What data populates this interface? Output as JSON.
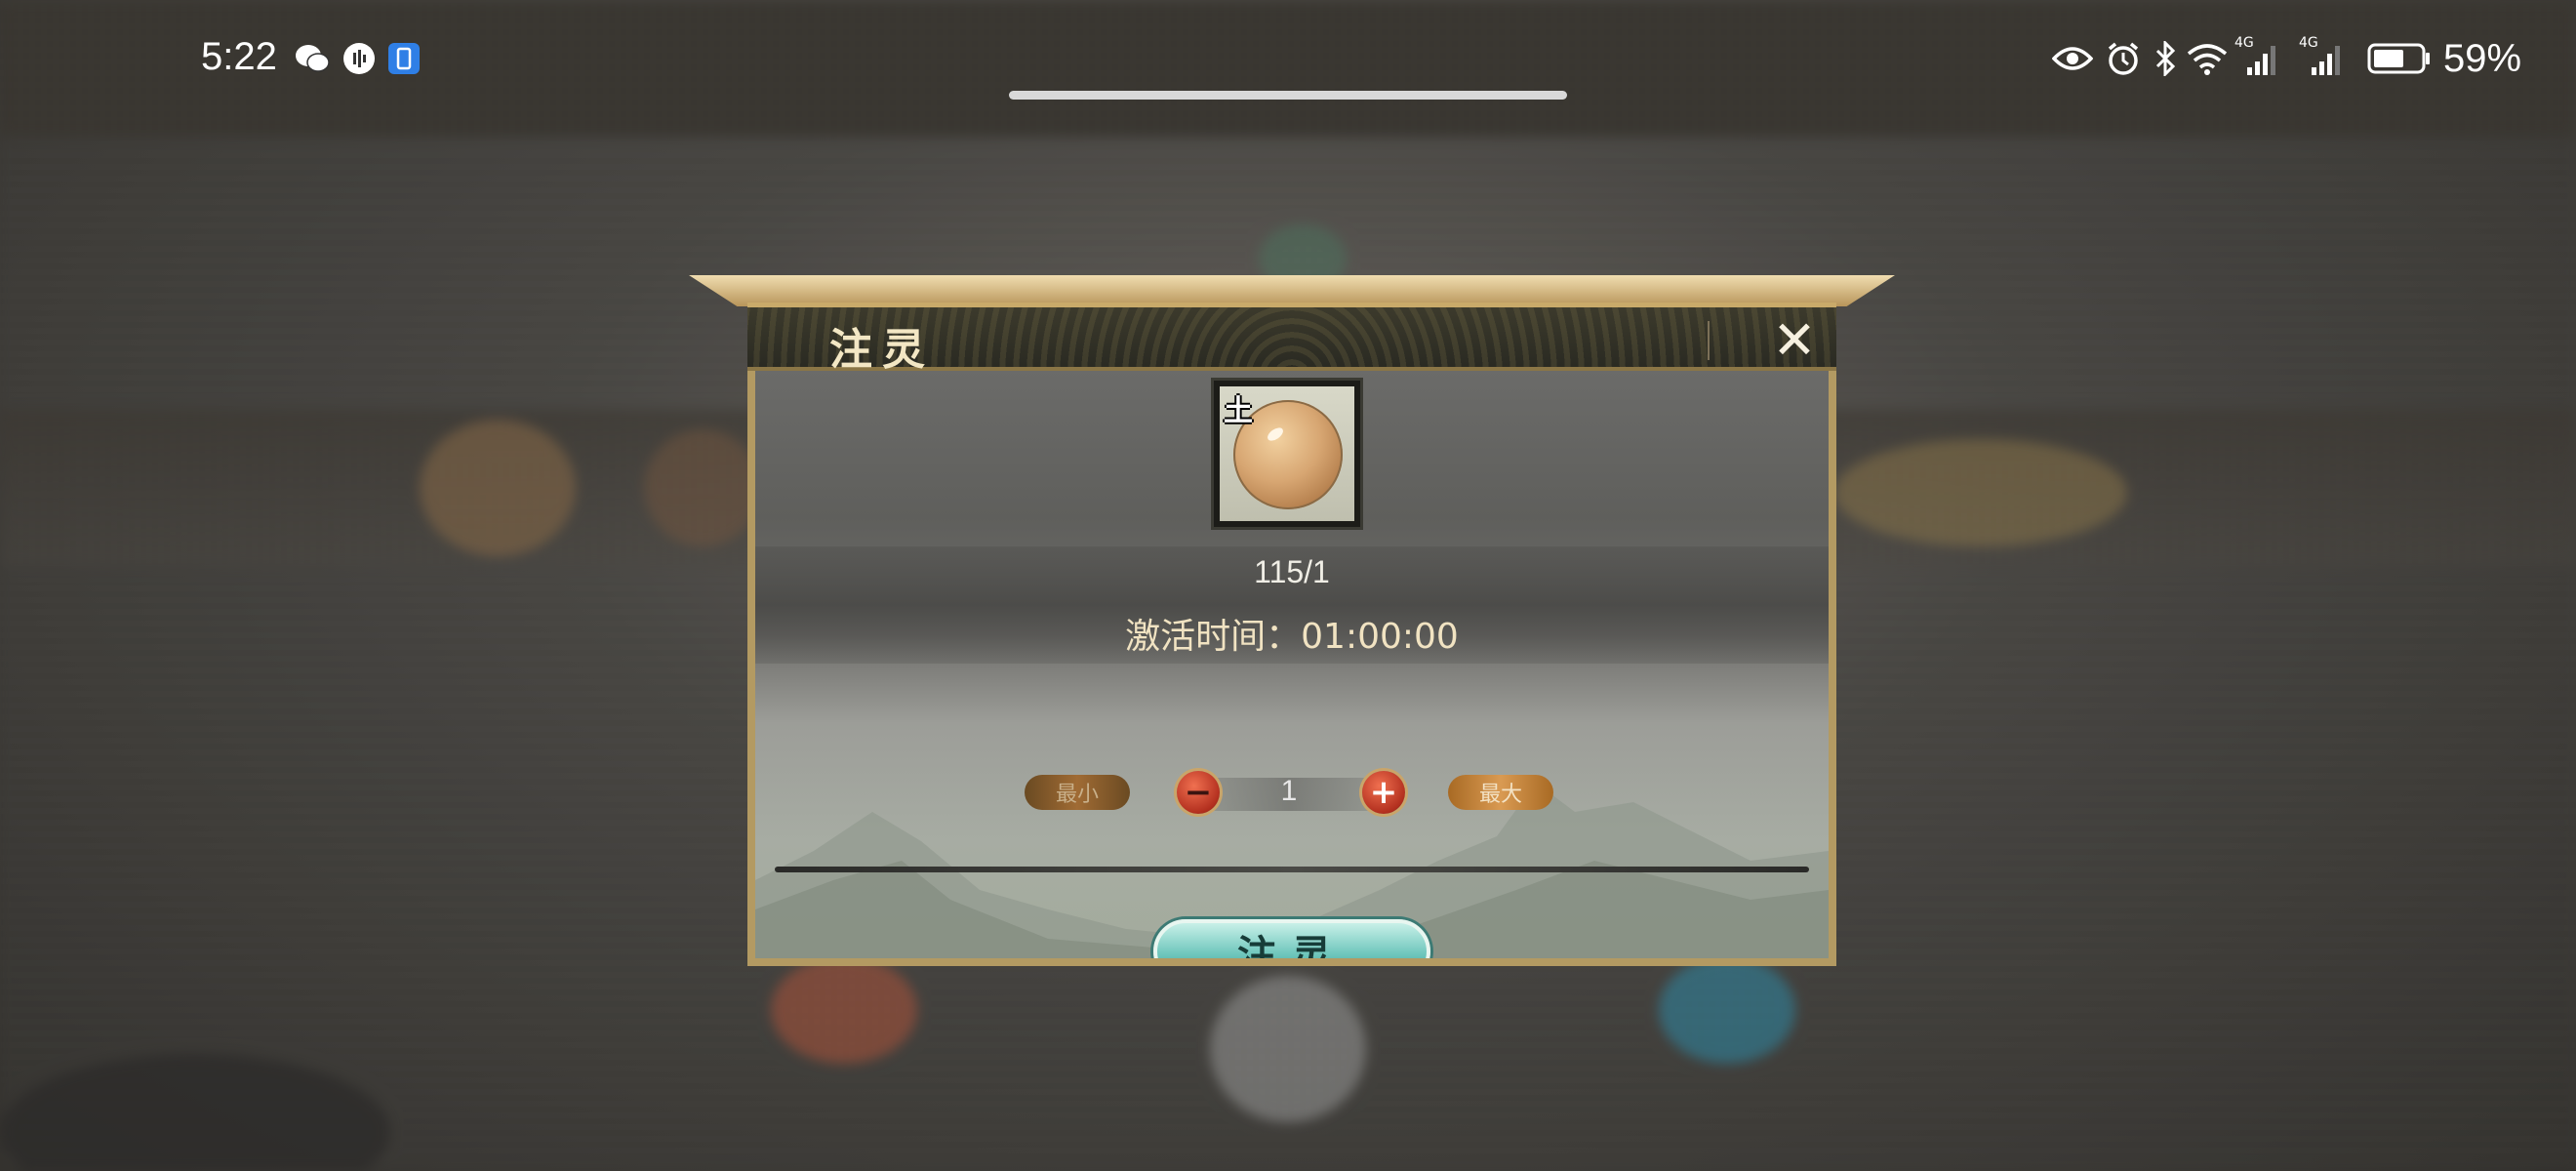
{
  "status_bar": {
    "time": "5:22",
    "battery_percent": "59%",
    "network_badges": [
      "4G",
      "4G"
    ],
    "left_icons": [
      "wechat-icon",
      "voice-assistant-icon",
      "screen-share-icon"
    ],
    "right_icons": [
      "eye-icon",
      "alarm-icon",
      "bluetooth-icon",
      "wifi-icon",
      "signal-icon",
      "signal-icon",
      "battery-icon"
    ]
  },
  "dialog": {
    "title": "注灵",
    "item": {
      "element_tag": "土",
      "icon": "earth-orb-icon",
      "count": "115/1"
    },
    "activation_time": "激活时间：01:00:00",
    "stepper": {
      "min_label": "最小",
      "max_label": "最大",
      "value": "1",
      "minus_symbol": "−",
      "plus_symbol": "+"
    },
    "confirm_label": "注灵",
    "close_symbol": "✕"
  },
  "colors": {
    "frame_gold": "#b39a62",
    "confirm_teal": "#6ec6bc",
    "stepper_red": "#b3301f",
    "max_orange": "#d99a52"
  }
}
